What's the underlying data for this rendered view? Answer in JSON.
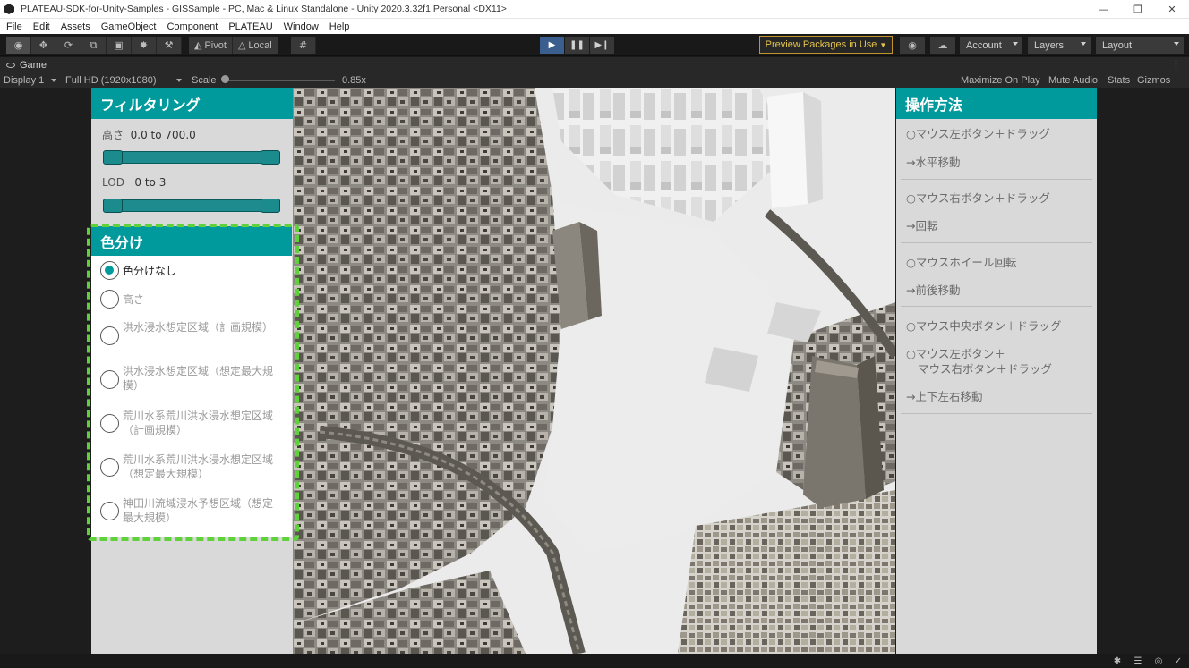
{
  "window": {
    "title": "PLATEAU-SDK-for-Unity-Samples - GISSample - PC, Mac & Linux Standalone - Unity 2020.3.32f1 Personal <DX11>",
    "buttons": [
      "minimize-icon",
      "restore-icon",
      "close-icon"
    ]
  },
  "menu": [
    "File",
    "Edit",
    "Assets",
    "GameObject",
    "Component",
    "PLATEAU",
    "Window",
    "Help"
  ],
  "toolbar": {
    "tools": [
      "view-tool-icon",
      "move-tool-icon",
      "rotate-tool-icon",
      "scale-tool-icon",
      "rect-tool-icon",
      "transform-tool-icon",
      "custom-tool-icon"
    ],
    "pivot_label": "Pivot",
    "local_label": "Local",
    "play_icons": [
      "play-icon",
      "pause-icon",
      "step-icon"
    ],
    "preview_packages": "Preview Packages in Use",
    "account": "Account",
    "layers": "Layers",
    "layout": "Layout"
  },
  "game_tab": {
    "label": "Game",
    "display": "Display 1",
    "resolution": "Full HD (1920x1080)",
    "scale_label": "Scale",
    "scale_value": "0.85x",
    "scale_fraction": 0.0,
    "maximize": "Maximize On Play",
    "mute": "Mute Audio",
    "stats": "Stats",
    "gizmos": "Gizmos"
  },
  "filter_panel": {
    "title": "フィルタリング",
    "height_label": "高さ",
    "height_range": "0.0 to 700.0",
    "lod_label": "LOD",
    "lod_range": "0 to 3"
  },
  "color_panel": {
    "title": "色分け",
    "options": [
      {
        "label": "色分けなし",
        "checked": true
      },
      {
        "label": "高さ",
        "checked": false
      },
      {
        "label": "洪水浸水想定区域（計画規模）",
        "checked": false
      },
      {
        "label": "洪水浸水想定区域（想定最大規模）",
        "checked": false
      },
      {
        "label": "荒川水系荒川洪水浸水想定区域（計画規模）",
        "checked": false
      },
      {
        "label": "荒川水系荒川洪水浸水想定区域（想定最大規模）",
        "checked": false
      },
      {
        "label": "神田川流域浸水予想区域（想定最大規模）",
        "checked": false
      }
    ]
  },
  "howto_panel": {
    "title": "操作方法",
    "items": [
      "○マウス左ボタン＋ドラッグ",
      "→水平移動",
      "○マウス右ボタン＋ドラッグ",
      "→回転",
      "○マウスホイール回転",
      "→前後移動",
      "○マウス中央ボタン＋ドラッグ",
      "○マウス左ボタン＋",
      "マウス右ボタン＋ドラッグ",
      "→上下左右移動"
    ]
  },
  "colors": {
    "accent": "#00999c",
    "highlight_border": "#5fd13b",
    "preview_packages": "#e6c44c"
  }
}
